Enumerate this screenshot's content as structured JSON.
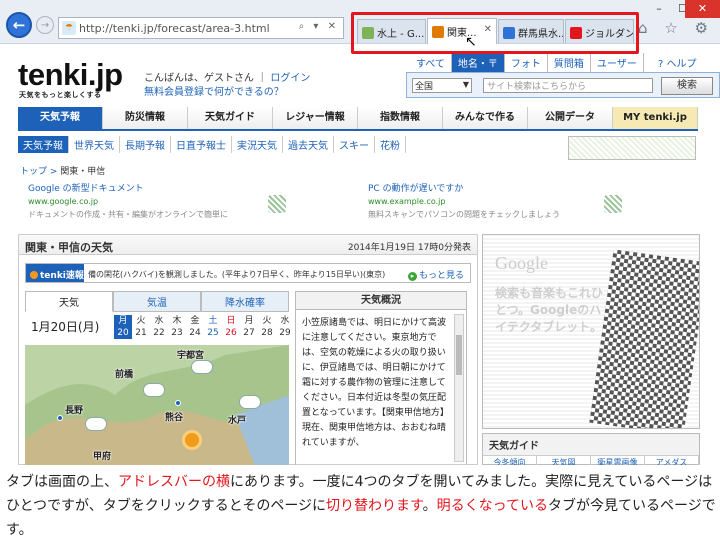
{
  "browser": {
    "url": "http://tenki.jp/forecast/area-3.html",
    "address_icons": "⌕ ▾ ✕",
    "tabs": [
      {
        "label": "水上 - G...",
        "icon_color": "#7fb35a"
      },
      {
        "label": "関東...",
        "icon_color": "#e07b00",
        "close": "✕"
      },
      {
        "label": "群馬県水...",
        "icon_color": "#2f73d8"
      },
      {
        "label": "ジョルダン...",
        "icon_color": "#e4161d"
      }
    ],
    "right_icons": "⌂ ☆ ⚙",
    "window_buttons": {
      "min": "–",
      "max": "☐",
      "close": "✕"
    },
    "highlight_color": "#e4161d"
  },
  "page": {
    "logo": "tenki.jp",
    "tagline": "天気をもっと楽しくする",
    "greeting": "こんばんは、ゲストさん",
    "login": "ログイン",
    "free_register": "無料会員登録で何ができるの？",
    "search_tabs": [
      "すべて",
      "地名・〒",
      "フォト",
      "質問箱",
      "ユーザー"
    ],
    "help": "ヘルプ",
    "search_select": "全国",
    "search_placeholder": "サイト検索はこちらから",
    "search_button": "検索",
    "global_nav": [
      "天気予報",
      "防災情報",
      "天気ガイド",
      "レジャー情報",
      "指数情報",
      "みんなで作る",
      "公開データ",
      "MY tenki.jp"
    ],
    "sub_nav": [
      "天気予報",
      "世界天気",
      "長期予報",
      "日直予報士",
      "実況天気",
      "過去天気",
      "スキー",
      "花粉"
    ],
    "breadcrumb": {
      "top": "トップ",
      "sep": " > ",
      "current": "関東・甲信"
    },
    "ads": [
      {
        "title": "Google の新型ドキュメント",
        "link": "www.google.co.jp",
        "desc": "ドキュメントの作成・共有・編集がオンラインで簡単に"
      },
      {
        "title": "PC の動作が遅いですか",
        "link": "www.example.co.jp",
        "desc": "無料スキャンでパソコンの問題をチェックしましょう"
      }
    ],
    "forecast": {
      "title": "関東・甲信の天気",
      "date": "2014年1月19日 17時0分発表",
      "flash_label": "tenki速報",
      "flash_text": "備の閑花(ハクバイ)を観測しました。(平年より7日早く、昨年より15日早い)(東京)",
      "flash_more": "もっと見る",
      "tabs": [
        "天気",
        "気温",
        "降水確率"
      ],
      "day": "1月20日(月)",
      "calendar": [
        {
          "w": "月",
          "d": "20",
          "cls": "sel"
        },
        {
          "w": "火",
          "d": "21",
          "cls": ""
        },
        {
          "w": "水",
          "d": "22",
          "cls": ""
        },
        {
          "w": "木",
          "d": "23",
          "cls": ""
        },
        {
          "w": "金",
          "d": "24",
          "cls": ""
        },
        {
          "w": "土",
          "d": "25",
          "cls": "sat"
        },
        {
          "w": "日",
          "d": "26",
          "cls": "sun"
        },
        {
          "w": "月",
          "d": "27",
          "cls": ""
        },
        {
          "w": "火",
          "d": "28",
          "cls": ""
        },
        {
          "w": "水",
          "d": "29",
          "cls": ""
        }
      ],
      "map_labels": [
        "宇都宮",
        "前橋",
        "長野",
        "熊谷",
        "水戸",
        "甲府"
      ],
      "overview_title": "天気概況",
      "overview_text": "小笠原諸島では、明日にかけて高波に注意してください。東京地方では、空気の乾燥による火の取り扱いに、伊豆諸島では、明日朝にかけて霜に対する農作物の管理に注意してください。日本付近は冬型の気圧配置となっています。【関東甲信地方】現在、関東甲信地方は、おおむね晴れていますが、"
    },
    "right_ad": {
      "brand": "Google",
      "text": "検索も音楽もこれひとつ。Googleのハイテクタブレット。"
    },
    "weather_guide": {
      "title": "天気ガイド",
      "tabs": [
        "今冬傾向",
        "天気図",
        "衛星雲画像",
        "アメダス"
      ]
    }
  },
  "caption": {
    "p1": "タブは画面の上、",
    "p2": "アドレスバーの横",
    "p3": "にあります。一度に4つのタブを開いてみました。実際に見えているページはひとつですが、タブをクリックするとそのページに",
    "p4": "切り替わります",
    "p5": "。",
    "p6": "明るくなっている",
    "p7": "タブが今見ているページです。"
  }
}
